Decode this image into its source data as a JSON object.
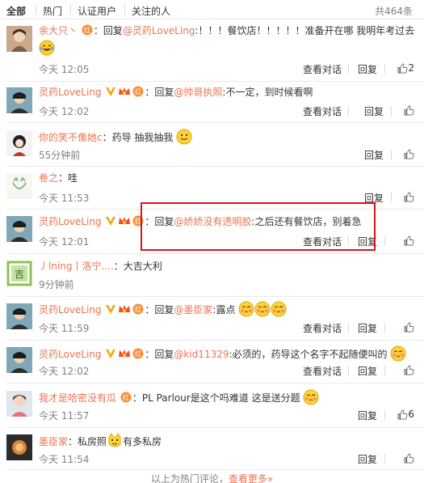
{
  "tabs": [
    {
      "label": "全部"
    },
    {
      "label": "热门"
    },
    {
      "label": "认证用户"
    },
    {
      "label": "关注的人"
    }
  ],
  "total_label": "共464条",
  "actions": {
    "view_conversation": "查看对话",
    "reply": "回复"
  },
  "reply_prefix": "回复",
  "comments": [
    {
      "user": "余大只丶",
      "reply_to": "@灵药LoveLing",
      "text": ":！！！餐饮店！！！！！准备开在哪 我明年考过去",
      "time": "今天 12:05",
      "likes": "2"
    },
    {
      "user": "灵药LoveLing",
      "reply_to": "@帅哥执照",
      "text": ":不一定，到时候看啊",
      "time": "今天 12:02"
    },
    {
      "user": "你的笑不像她c",
      "text": "：药导 抽我抽我",
      "time": "55分钟前"
    },
    {
      "user": "卷之",
      "text": "：哇",
      "time": "今天 11:53"
    },
    {
      "user": "灵药LoveLing",
      "reply_to": "@娇娇没有透明胶",
      "text": ":之后还有餐饮店，别着急",
      "time": "今天 12:01"
    },
    {
      "user": "丿lning丨洛宁....",
      "text": "：大吉大利",
      "time": "9分钟前"
    },
    {
      "user": "灵药LoveLing",
      "reply_to": "@墨臣家",
      "text": ":露点",
      "time": "今天 11:59"
    },
    {
      "user": "灵药LoveLing",
      "reply_to": "@kid11329",
      "text": ":必须的，药导这个名字不起随便叫的",
      "time": "今天 12:02"
    },
    {
      "user": "我才是哈密没有瓜",
      "text": "：PL Parlour是这个吗难道 这是送分题",
      "time": "今天 11:57",
      "likes": "6"
    },
    {
      "user": "墨臣家",
      "text": "：私房照",
      "text_after": "有多私房",
      "time": "今天 11:54"
    }
  ],
  "footer": {
    "text": "以上为热门评论，",
    "more": "查看更多»"
  },
  "colors": {
    "link": "#eb7350",
    "highlight": "#d9141e",
    "muted": "#808080"
  }
}
